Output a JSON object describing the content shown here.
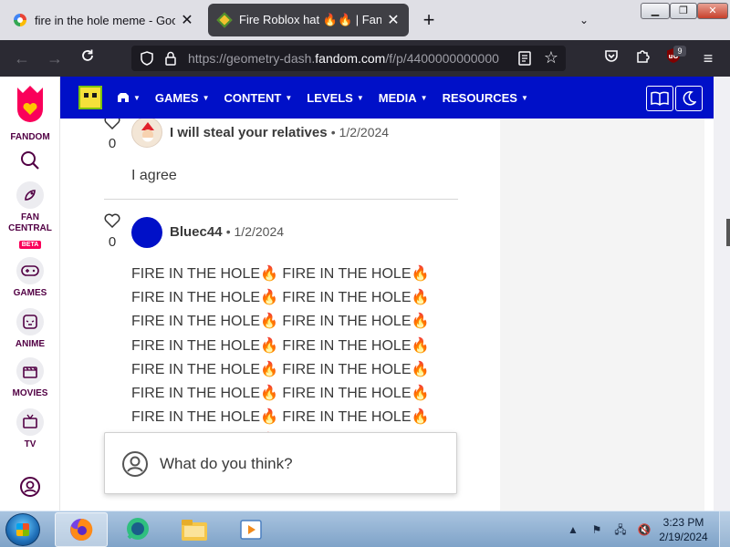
{
  "browser": {
    "tabs": [
      {
        "title": "fire in the hole meme - Google",
        "active": false
      },
      {
        "title": "Fire Roblox hat 🔥🔥 | Fandom",
        "active": true
      }
    ],
    "url_prefix": "https://geometry-dash.",
    "url_host": "fandom.com",
    "url_path": "/f/p/4400000000000",
    "extension_badge": "9",
    "new_tab_label": "+",
    "close_glyph": "✕",
    "tablist_glyph": "⌄"
  },
  "fandom_rail": {
    "items": [
      {
        "label": "FANDOM"
      },
      {
        "label": "FAN CENTRAL",
        "badge": "BETA"
      },
      {
        "label": "GAMES"
      },
      {
        "label": "ANIME"
      },
      {
        "label": "MOVIES"
      },
      {
        "label": "TV"
      }
    ]
  },
  "wiki_nav": {
    "items": [
      "GAMES",
      "CONTENT",
      "LEVELS",
      "MEDIA",
      "RESOURCES"
    ],
    "caret": "▼"
  },
  "comments": [
    {
      "username": "I will steal your relatives",
      "date": "1/2/2024",
      "likes": "0",
      "text": "I agree",
      "avatar_color": "#f3e6d6"
    },
    {
      "username": "Bluec44",
      "date": "1/2/2024",
      "likes": "0",
      "text": "FIRE IN THE HOLE🔥 FIRE IN THE HOLE🔥 FIRE IN THE HOLE🔥 FIRE IN THE HOLE🔥 FIRE IN THE HOLE🔥 FIRE IN THE HOLE🔥 FIRE IN THE HOLE🔥 FIRE IN THE HOLE🔥 FIRE IN THE HOLE🔥 FIRE IN THE HOLE🔥 FIRE IN THE HOLE🔥 FIRE IN THE HOLE🔥 FIRE IN THE HOLE🔥 FIRE IN THE HOLE🔥 FIRE IN THE HOLE🔥 FIRE IN THE HOLE",
      "avatar_color": "#0010c8"
    }
  ],
  "separator": "•",
  "reply_box": {
    "placeholder": "What do you think?"
  },
  "taskbar": {
    "time": "3:23 PM",
    "date": "2/19/2024"
  },
  "colors": {
    "fandom_magenta": "#fa005a",
    "wiki_nav_bg": "#0010c8",
    "browser_dark": "#2b2a33"
  }
}
